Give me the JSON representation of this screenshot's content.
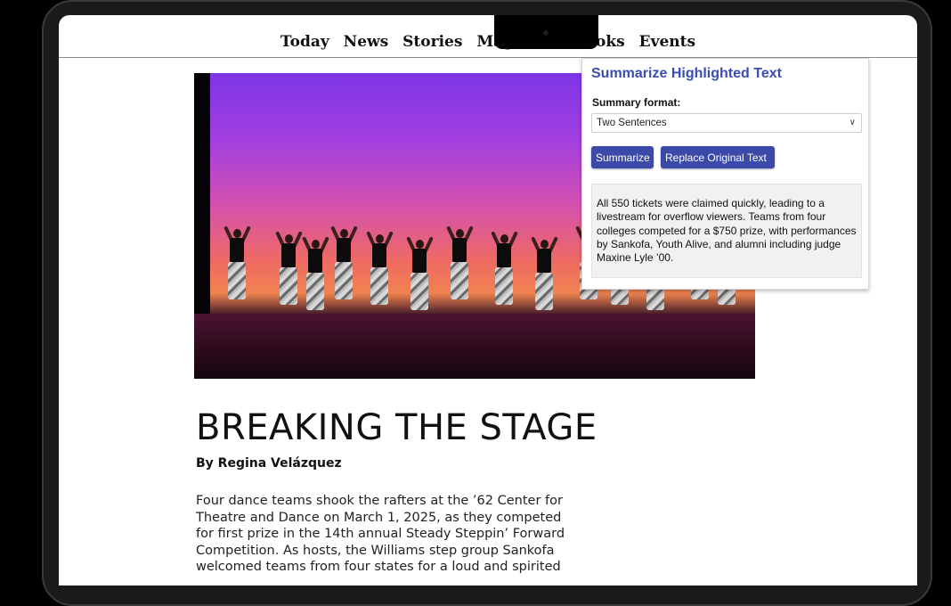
{
  "nav": {
    "items": [
      "Today",
      "News",
      "Stories",
      "Magazine",
      "Books",
      "Events"
    ]
  },
  "article": {
    "title": "BREAKING THE STAGE",
    "byline": "By Regina Velázquez",
    "body": "Four dance teams shook the rafters at the ’62 Center for Theatre and Dance on March 1, 2025, as they competed for first prize in the 14th annual Steady Steppin’ Forward Competition. As hosts, the Williams step group Sankofa welcomed teams from four states for a loud and spirited"
  },
  "summarizer": {
    "title": "Summarize Highlighted Text",
    "format_label": "Summary format:",
    "format_value": "Two Sentences",
    "summarize_button": "Summarize",
    "replace_button": "Replace Original Text",
    "summary_text": "All 550 tickets were claimed quickly, leading to a livestream for overflow viewers. Teams from four colleges competed for a $750 prize, with performances by Sankofa, Youth Alive, and alumni including judge Maxine Lyle ’00."
  },
  "colors": {
    "accent": "#3b4aa8",
    "title_accent": "#3b4db3"
  },
  "icons": {
    "dropdown": "chevron-down-icon"
  }
}
